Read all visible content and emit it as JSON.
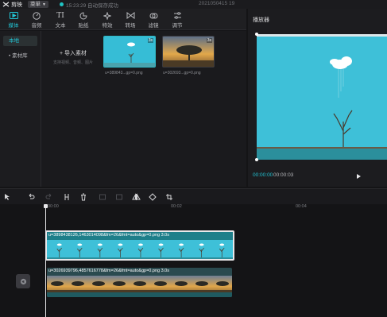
{
  "titlebar": {
    "app_name": "剪映",
    "menu_label": "菜单",
    "save_status": "15:23:29 自动保存成功",
    "draft_title": "2021050415 19"
  },
  "tools": [
    {
      "label": "媒体",
      "icon": "media-icon"
    },
    {
      "label": "音频",
      "icon": "audio-icon"
    },
    {
      "label": "文本",
      "icon": "text-icon"
    },
    {
      "label": "贴纸",
      "icon": "sticker-icon"
    },
    {
      "label": "特效",
      "icon": "effects-icon"
    },
    {
      "label": "转场",
      "icon": "transition-icon"
    },
    {
      "label": "滤镜",
      "icon": "filter-icon"
    },
    {
      "label": "调节",
      "icon": "adjust-icon"
    }
  ],
  "sidebar": {
    "items": [
      {
        "label": "本地"
      },
      {
        "label": "• 素材库"
      }
    ]
  },
  "media": {
    "import_label": "导入素材",
    "import_sub": "支持视频、音频、图片",
    "items": [
      {
        "name": "u=389843...gp=0.png",
        "badge": "3s"
      },
      {
        "name": "u=302693...gp=0.png",
        "badge": "3s"
      }
    ]
  },
  "player": {
    "title": "播放器",
    "current_time": "00:00:00",
    "total_time": "00:00:03"
  },
  "timeline": {
    "ticks": [
      "00:00",
      "00:02",
      "00:04"
    ],
    "tracks": [
      {
        "caption": "u=3898438126,1463014098&fm=26&fmt=auto&gp=0.png  3.0s"
      },
      {
        "caption": "u=3026939796,4857616778&fm=26&fmt=auto&gp=0.png  3.0s"
      }
    ]
  },
  "colors": {
    "accent": "#22c6d6",
    "background": "#141416",
    "sky": "#3ec0d8"
  }
}
